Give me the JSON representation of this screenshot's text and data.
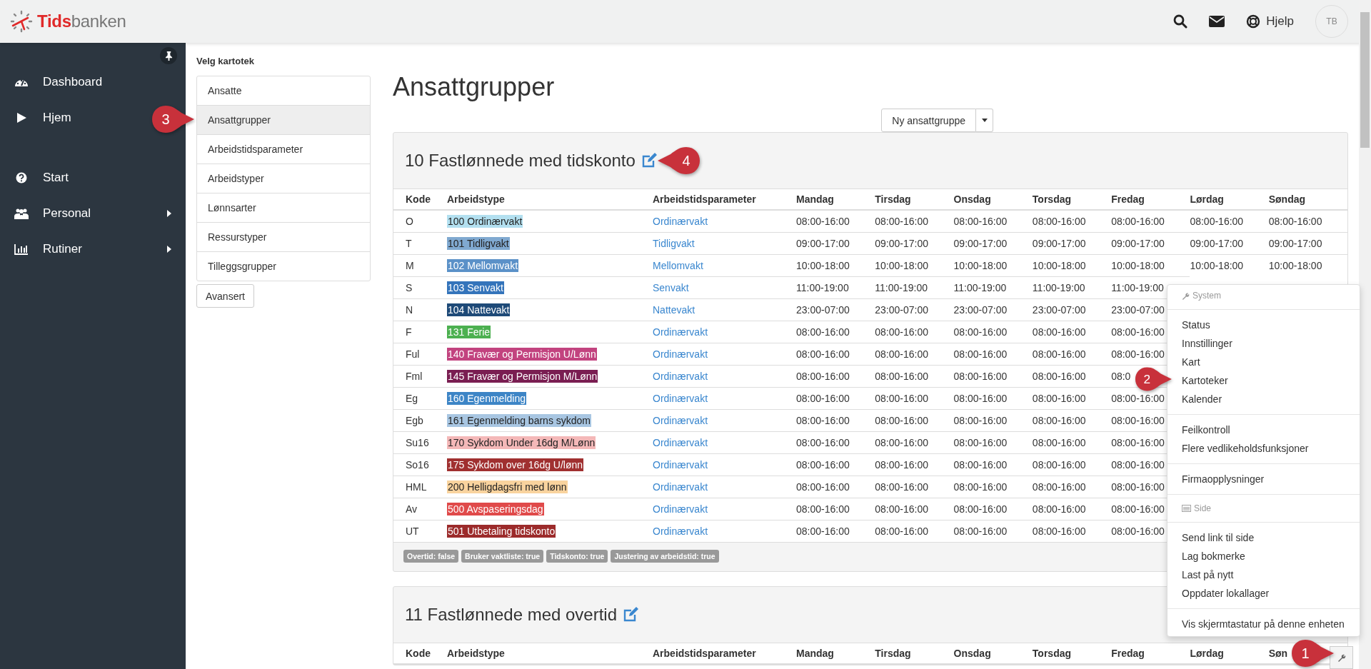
{
  "logo": {
    "brand_a": "Tids",
    "brand_b": "banken"
  },
  "topbar": {
    "help": "Hjelp",
    "avatar": "TB"
  },
  "sidebar": {
    "sections": [
      [
        {
          "label": "Dashboard",
          "expandable": false
        },
        {
          "label": "Hjem",
          "expandable": false
        }
      ],
      [
        {
          "label": "Start",
          "expandable": false
        },
        {
          "label": "Personal",
          "expandable": true
        },
        {
          "label": "Rutiner",
          "expandable": true
        }
      ]
    ]
  },
  "picker": {
    "heading": "Velg kartotek",
    "items": [
      {
        "label": "Ansatte",
        "selected": false
      },
      {
        "label": "Ansattgrupper",
        "selected": true
      },
      {
        "label": "Arbeidstidsparameter",
        "selected": false
      },
      {
        "label": "Arbeidstyper",
        "selected": false
      },
      {
        "label": "Lønnsarter",
        "selected": false
      },
      {
        "label": "Ressurstyper",
        "selected": false
      },
      {
        "label": "Tilleggsgrupper",
        "selected": false
      }
    ],
    "advanced": "Avansert"
  },
  "page_title": "Ansattgrupper",
  "new_button": "Ny ansattgruppe",
  "groups": [
    {
      "title": "10 Fastlønnede med tidskonto",
      "columns": [
        "Kode",
        "Arbeidstype",
        "Arbeidstidsparameter",
        "Mandag",
        "Tirsdag",
        "Onsdag",
        "Torsdag",
        "Fredag",
        "Lørdag",
        "Søndag"
      ],
      "rows": [
        {
          "code": "O",
          "type": "100 Ordinærvakt",
          "color": "#b3e0f0",
          "param": "Ordinærvakt",
          "days": [
            "08:00-16:00",
            "08:00-16:00",
            "08:00-16:00",
            "08:00-16:00",
            "08:00-16:00",
            "08:00-16:00",
            "08:00-16:00"
          ]
        },
        {
          "code": "T",
          "type": "101 Tidligvakt",
          "color": "#80a9d0",
          "param": "Tidligvakt",
          "days": [
            "09:00-17:00",
            "09:00-17:00",
            "09:00-17:00",
            "09:00-17:00",
            "09:00-17:00",
            "09:00-17:00",
            "09:00-17:00"
          ]
        },
        {
          "code": "M",
          "type": "102 Mellomvakt",
          "color": "#5b91c8",
          "param": "Mellomvakt",
          "days": [
            "10:00-18:00",
            "10:00-18:00",
            "10:00-18:00",
            "10:00-18:00",
            "10:00-18:00",
            "10:00-18:00",
            "10:00-18:00"
          ]
        },
        {
          "code": "S",
          "type": "103 Senvakt",
          "color": "#3474bb",
          "param": "Senvakt",
          "days": [
            "11:00-19:00",
            "11:00-19:00",
            "11:00-19:00",
            "11:00-19:00",
            "11:00-19:00"
          ]
        },
        {
          "code": "N",
          "type": "104 Nattevakt",
          "color": "#1e4a78",
          "param": "Nattevakt",
          "days": [
            "23:00-07:00",
            "23:00-07:00",
            "23:00-07:00",
            "23:00-07:00",
            "23:00-07:00"
          ]
        },
        {
          "code": "F",
          "type": "131 Ferie",
          "color": "#4cb050",
          "param": "Ordinærvakt",
          "days": [
            "08:00-16:00",
            "08:00-16:00",
            "08:00-16:00",
            "08:00-16:00",
            "08:00-16:00"
          ]
        },
        {
          "code": "Ful",
          "type": "140 Fravær og Permisjon U/Lønn",
          "color": "#c2437f",
          "param": "Ordinærvakt",
          "days": [
            "08:00-16:00",
            "08:00-16:00",
            "08:00-16:00",
            "08:00-16:00",
            "08:00-16:00"
          ]
        },
        {
          "code": "Fml",
          "type": "145 Fravær og Permisjon M/Lønn",
          "color": "#7a1e52",
          "param": "Ordinærvakt",
          "days": [
            "08:00-16:00",
            "08:00-16:00",
            "08:00-16:00",
            "08:00-16:00",
            "08:0"
          ]
        },
        {
          "code": "Eg",
          "type": "160 Egenmelding",
          "color": "#3d85c6",
          "param": "Ordinærvakt",
          "days": [
            "08:00-16:00",
            "08:00-16:00",
            "08:00-16:00",
            "08:00-16:00",
            "08:00-16:00"
          ]
        },
        {
          "code": "Egb",
          "type": "161 Egenmelding barns sykdom",
          "color": "#a8c6e2",
          "param": "Ordinærvakt",
          "days": [
            "08:00-16:00",
            "08:00-16:00",
            "08:00-16:00",
            "08:00-16:00",
            "08:00-16:00"
          ]
        },
        {
          "code": "Su16",
          "type": "170 Sykdom Under 16dg M/Lønn",
          "color": "#f4b8b8",
          "param": "Ordinærvakt",
          "days": [
            "08:00-16:00",
            "08:00-16:00",
            "08:00-16:00",
            "08:00-16:00",
            "08:00-16:00"
          ]
        },
        {
          "code": "So16",
          "type": "175 Sykdom over 16dg U/lønn",
          "color": "#a03030",
          "param": "Ordinærvakt",
          "days": [
            "08:00-16:00",
            "08:00-16:00",
            "08:00-16:00",
            "08:00-16:00",
            "08:00-16:00"
          ]
        },
        {
          "code": "HML",
          "type": "200 Helligdagsfri med lønn",
          "color": "#f9d39e",
          "param": "Ordinærvakt",
          "days": [
            "08:00-16:00",
            "08:00-16:00",
            "08:00-16:00",
            "08:00-16:00",
            "08:00-16:00"
          ]
        },
        {
          "code": "Av",
          "type": "500 Avspaseringsdag",
          "color": "#e04a4a",
          "param": "Ordinærvakt",
          "days": [
            "08:00-16:00",
            "08:00-16:00",
            "08:00-16:00",
            "08:00-16:00",
            "08:00-16:00"
          ]
        },
        {
          "code": "UT",
          "type": "501 Utbetaling tidskonto",
          "color": "#9c2b2b",
          "param": "Ordinærvakt",
          "days": [
            "08:00-16:00",
            "08:00-16:00",
            "08:00-16:00",
            "08:00-16:00",
            "08:00-16:00"
          ]
        }
      ],
      "badges": [
        "Overtid: false",
        "Bruker vaktliste: true",
        "Tidskonto: true",
        "Justering av arbeidstid: true"
      ]
    },
    {
      "title": "11 Fastlønnede med overtid",
      "columns": [
        "Kode",
        "Arbeidstype",
        "Arbeidstidsparameter",
        "Mandag",
        "Tirsdag",
        "Onsdag",
        "Torsdag",
        "Fredag",
        "Lørdag",
        "Søn"
      ]
    }
  ],
  "menu": {
    "groups": [
      {
        "header": "System"
      },
      {
        "items": [
          "Status",
          "Innstillinger",
          "Kart",
          "Kartoteker",
          "Kalender"
        ]
      },
      {
        "items": [
          "Feilkontroll",
          "Flere vedlikeholdsfunksjoner"
        ]
      },
      {
        "items": [
          "Firmaopplysninger"
        ]
      },
      {
        "header": "Side"
      },
      {
        "items": [
          "Send link til side",
          "Lag bokmerke",
          "Last på nytt",
          "Oppdater lokallager"
        ]
      },
      {
        "items": [
          "Vis skjermtastatur på denne enheten"
        ]
      }
    ]
  },
  "callouts": [
    "3",
    "4",
    "2",
    "1"
  ]
}
